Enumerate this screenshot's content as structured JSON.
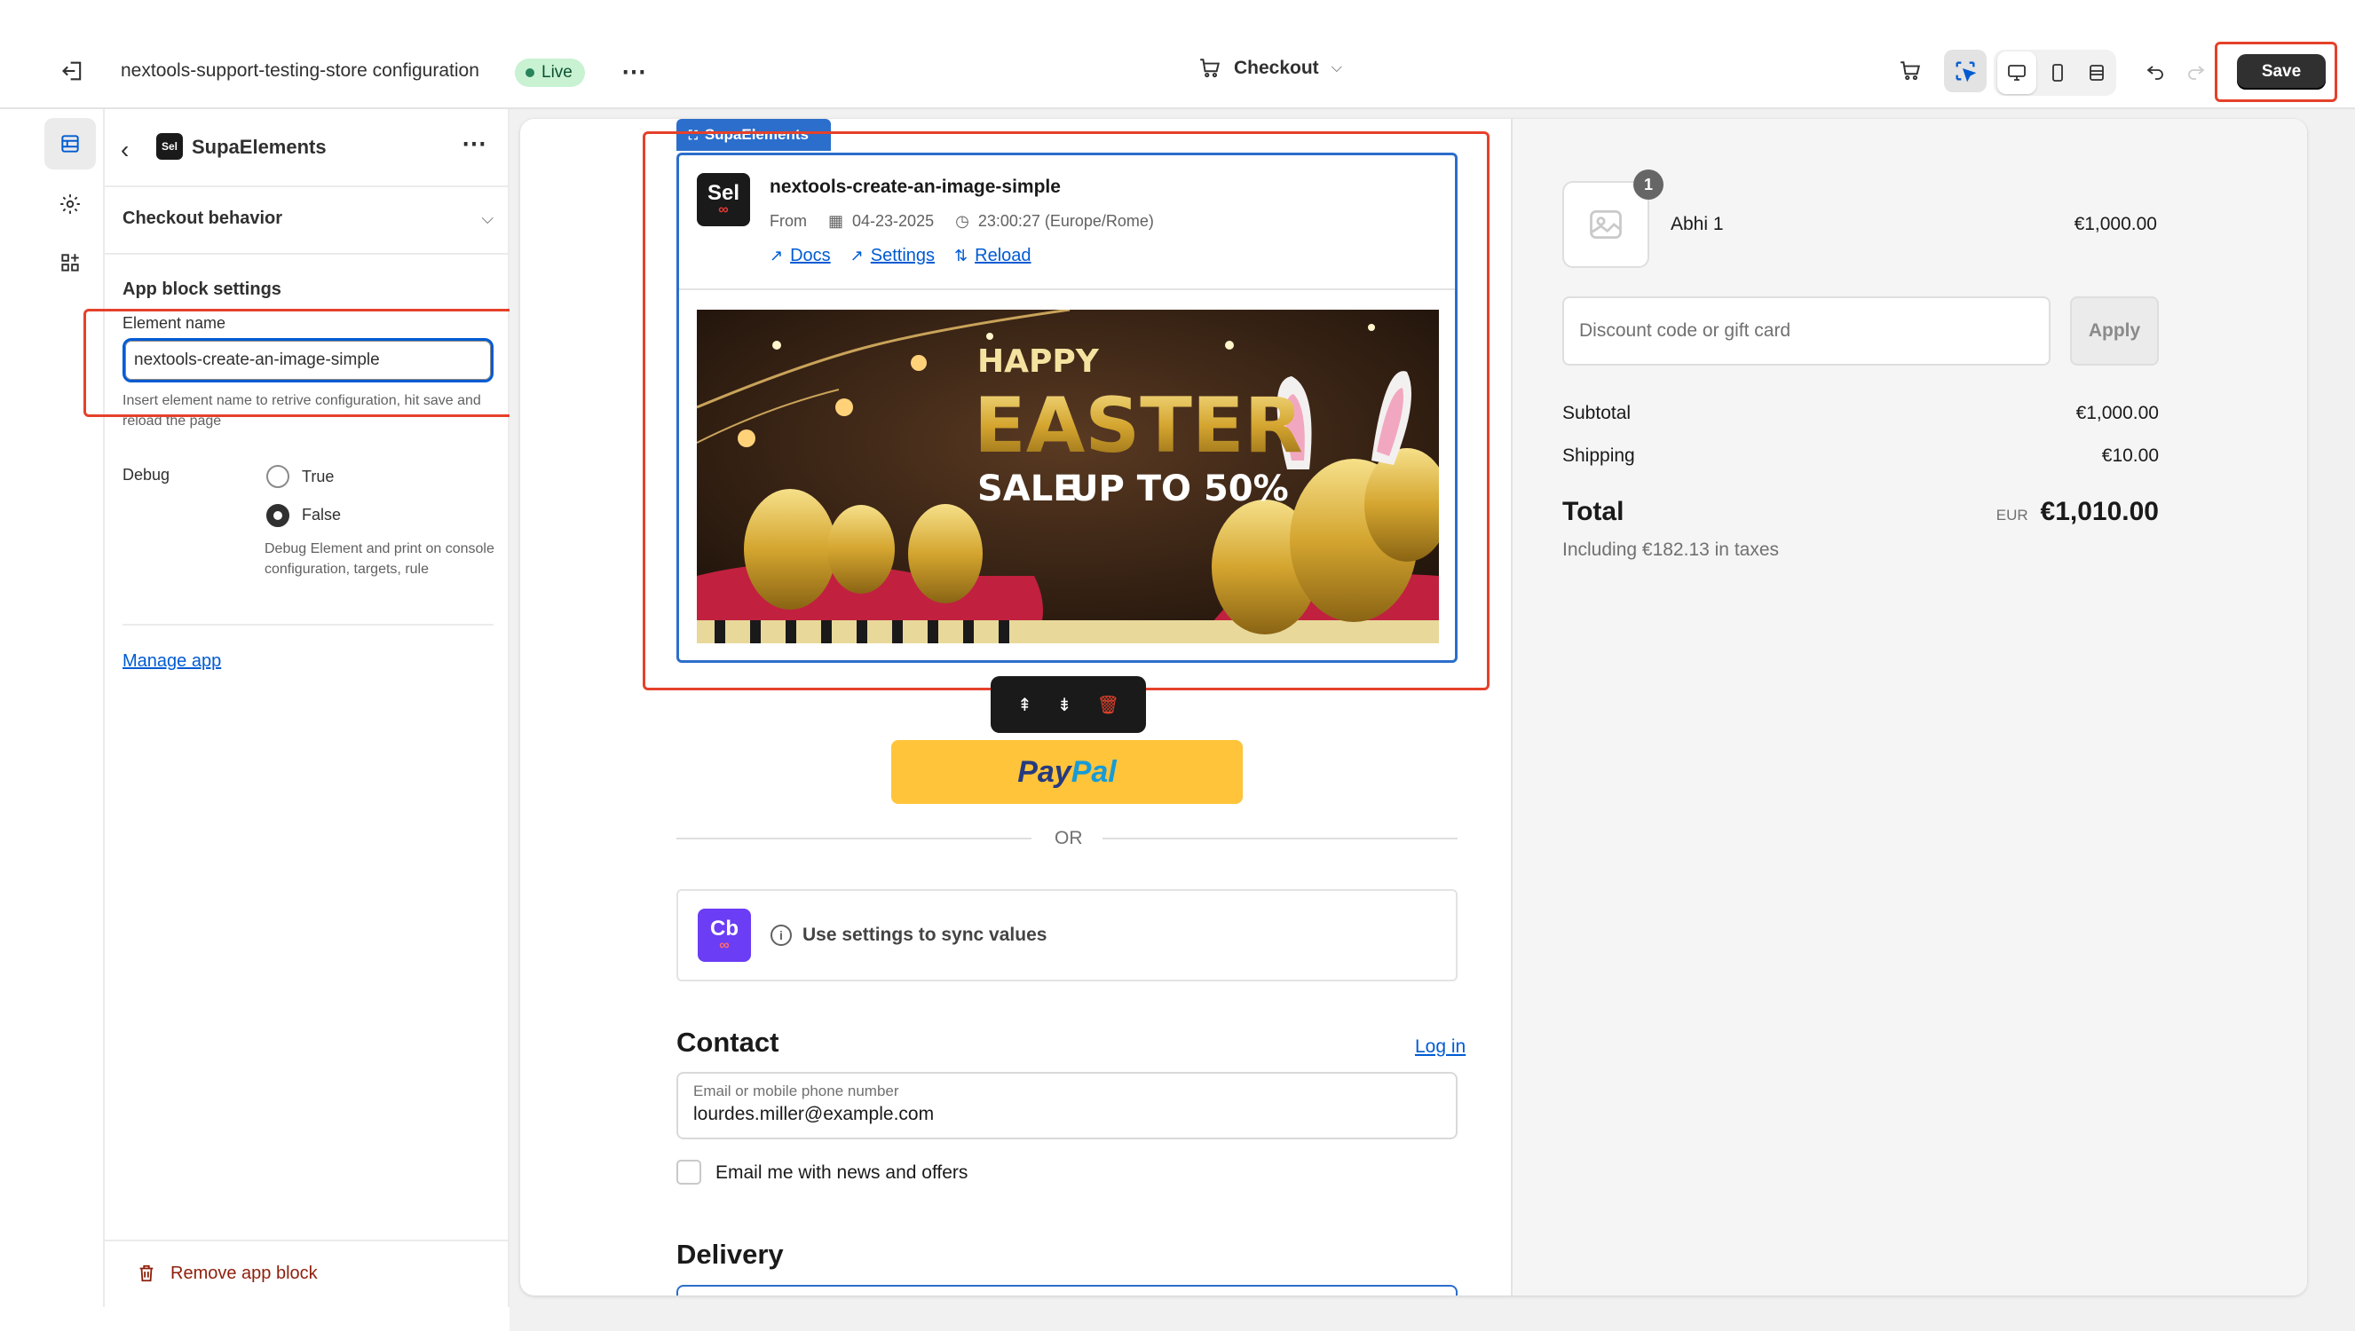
{
  "topbar": {
    "store_title": "nextools-support-testing-store configuration",
    "status_badge": "Live",
    "page_selector": "Checkout",
    "save_label": "Save"
  },
  "panel": {
    "title": "SupaElements",
    "app_icon_text": "Sel",
    "section_checkout_behavior": "Checkout behavior",
    "section_app_block_settings": "App block settings",
    "element_name_label": "Element name",
    "element_name_value": "nextools-create-an-image-simple",
    "element_name_help": "Insert element name to retrive configuration, hit save and reload the page",
    "debug_label": "Debug",
    "debug_options": [
      "True",
      "False"
    ],
    "debug_selected": "False",
    "debug_help": "Debug Element and print on console configuration, targets, rule",
    "manage_app": "Manage app",
    "remove_block": "Remove app block"
  },
  "block": {
    "tag": "SupaElements",
    "logo_text": "Sel",
    "element_title": "nextools-create-an-image-simple",
    "from_label": "From",
    "date": "04-23-2025",
    "time": "23:00:27 (Europe/Rome)",
    "links": [
      "Docs",
      "Settings",
      "Reload"
    ],
    "banner": {
      "line1": "HAPPY",
      "line2": "EASTER",
      "line3": "SALE",
      "line4": "UP TO 50%"
    }
  },
  "checkout": {
    "paypal_text_1": "Pay",
    "paypal_text_2": "Pal",
    "or_text": "OR",
    "sync_logo": "Cb",
    "sync_text": "Use settings to sync values",
    "contact_heading": "Contact",
    "login_link": "Log in",
    "email_label": "Email or mobile phone number",
    "email_value": "lourdes.miller@example.com",
    "newsletter_label": "Email me with news and offers",
    "delivery_heading": "Delivery"
  },
  "summary": {
    "item_qty": "1",
    "item_name": "Abhi 1",
    "item_price": "€1,000.00",
    "discount_placeholder": "Discount code or gift card",
    "apply_label": "Apply",
    "subtotal_label": "Subtotal",
    "subtotal_value": "€1,000.00",
    "shipping_label": "Shipping",
    "shipping_value": "€10.00",
    "total_label": "Total",
    "currency": "EUR",
    "total_value": "€1,010.00",
    "taxes_note": "Including €182.13 in taxes"
  },
  "colors": {
    "accent_blue": "#2c6ecb",
    "highlight_red": "#e5412a",
    "live_green": "#c8f2d2",
    "paypal_yellow": "#ffc439",
    "sync_purple": "#6b3df5"
  }
}
